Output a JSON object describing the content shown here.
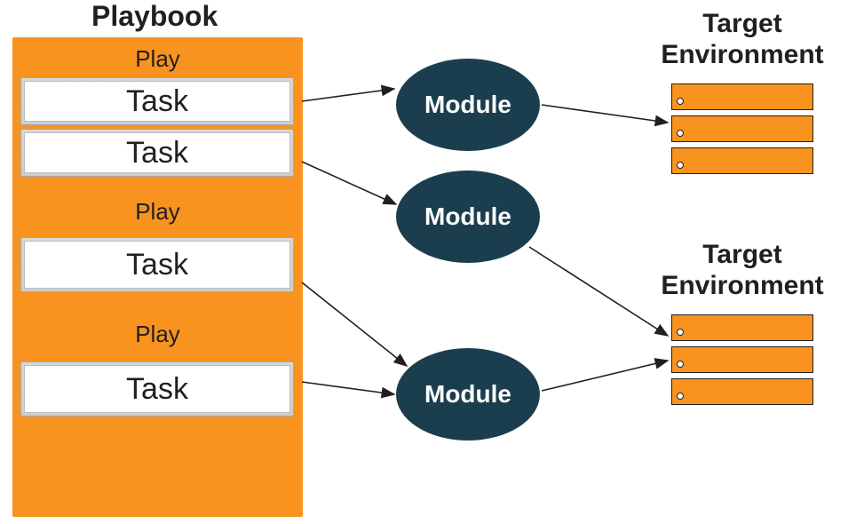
{
  "playbook": {
    "title": "Playbook",
    "plays": [
      {
        "label": "Play",
        "tasks": [
          "Task",
          "Task"
        ]
      },
      {
        "label": "Play",
        "tasks": [
          "Task"
        ]
      },
      {
        "label": "Play",
        "tasks": [
          "Task"
        ]
      }
    ]
  },
  "modules": [
    {
      "label": "Module"
    },
    {
      "label": "Module"
    },
    {
      "label": "Module"
    }
  ],
  "targets": [
    {
      "title_line1": "Target",
      "title_line2": "Environment",
      "servers": 3
    },
    {
      "title_line1": "Target",
      "title_line2": "Environment",
      "servers": 3
    }
  ],
  "colors": {
    "orange": "#F7931E",
    "dark_teal": "#1B3E4F",
    "text": "#231F20"
  },
  "diagram_flow": [
    {
      "from": "play1.task1",
      "to": "module1"
    },
    {
      "from": "play1.task2",
      "to": "module2"
    },
    {
      "from": "play2.task1",
      "to": "module3"
    },
    {
      "from": "play3.task1",
      "to": "module3"
    },
    {
      "from": "module1",
      "to": "target1"
    },
    {
      "from": "module2",
      "to": "target2"
    },
    {
      "from": "module3",
      "to": "target2"
    }
  ]
}
